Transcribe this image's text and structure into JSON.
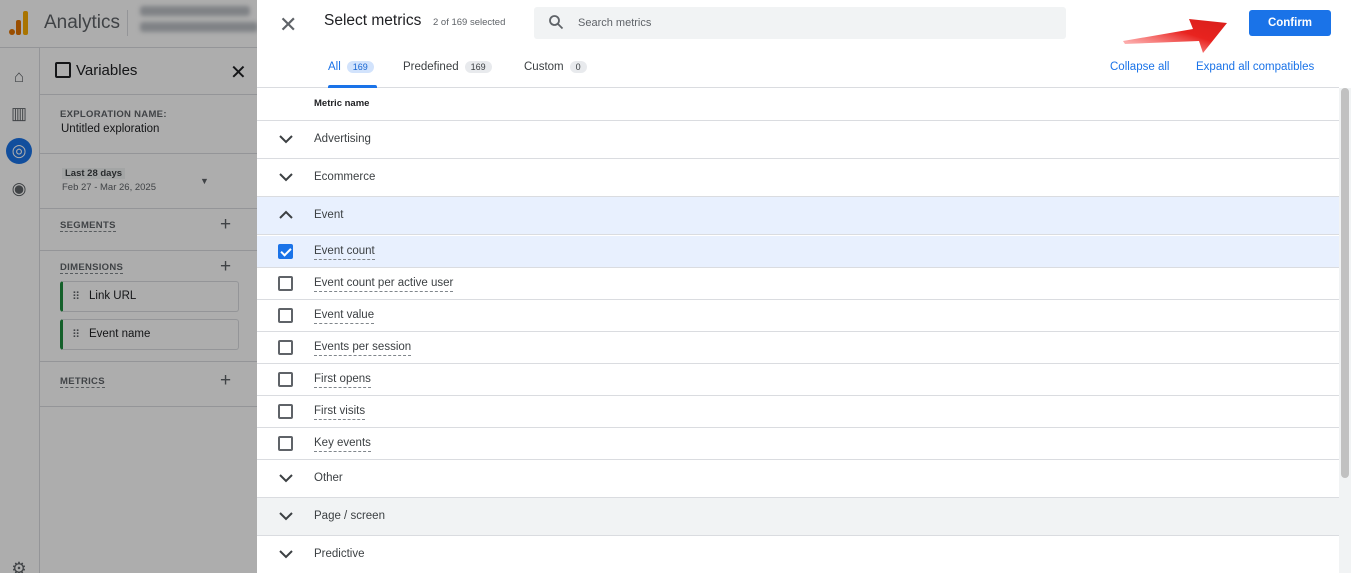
{
  "app": {
    "title": "Analytics",
    "rail_icons": [
      "home-icon",
      "reports-icon",
      "explore-icon",
      "advertising-icon",
      "settings-icon"
    ]
  },
  "variables_panel": {
    "title": "Variables",
    "exploration_name_label": "EXPLORATION NAME:",
    "exploration_name_value": "Untitled exploration",
    "date_range_label": "Last 28 days",
    "date_range_value": "Feb 27 - Mar 26, 2025",
    "segments_label": "SEGMENTS",
    "dimensions_label": "DIMENSIONS",
    "dimensions": [
      "Link URL",
      "Event name"
    ],
    "metrics_label": "METRICS"
  },
  "modal": {
    "title": "Select metrics",
    "selected_count": "2 of 169 selected",
    "search_placeholder": "Search metrics",
    "confirm_label": "Confirm",
    "tabs": [
      {
        "label": "All",
        "count": "169"
      },
      {
        "label": "Predefined",
        "count": "169"
      },
      {
        "label": "Custom",
        "count": "0"
      }
    ],
    "collapse_all_label": "Collapse all",
    "expand_all_label": "Expand all compatibles",
    "column_header": "Metric name",
    "groups": {
      "advertising": "Advertising",
      "ecommerce": "Ecommerce",
      "event": "Event",
      "other": "Other",
      "page_screen": "Page / screen",
      "predictive": "Predictive"
    },
    "event_items": [
      {
        "label": "Event count",
        "checked": true
      },
      {
        "label": "Event count per active user",
        "checked": false
      },
      {
        "label": "Event value",
        "checked": false
      },
      {
        "label": "Events per session",
        "checked": false
      },
      {
        "label": "First opens",
        "checked": false
      },
      {
        "label": "First visits",
        "checked": false
      },
      {
        "label": "Key events",
        "checked": false
      }
    ]
  },
  "colors": {
    "accent": "#1a73e8",
    "highlight_row": "#e8f0fe",
    "arrow": "#e8231f"
  }
}
